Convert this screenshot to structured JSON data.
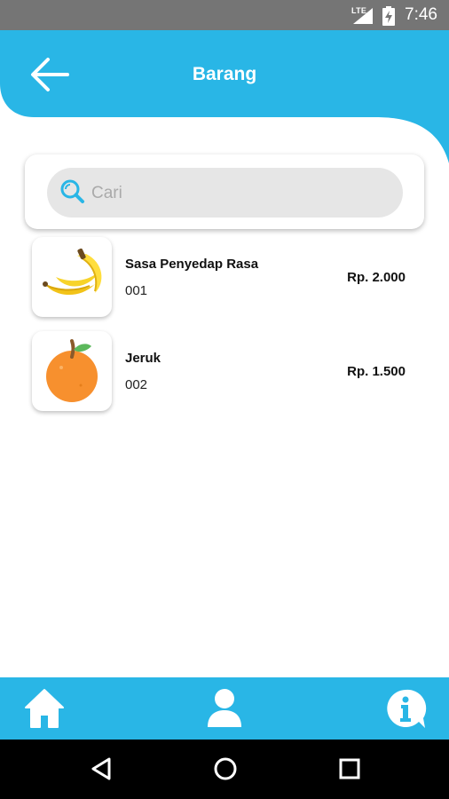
{
  "status_bar": {
    "network": "LTE",
    "time": "7:46"
  },
  "header": {
    "title": "Barang",
    "back_icon": "arrow-left-icon",
    "color": "#29b6e6"
  },
  "search": {
    "placeholder": "Cari",
    "value": "",
    "icon": "search-icon"
  },
  "items": [
    {
      "name": "Sasa Penyedap Rasa",
      "code": "001",
      "price": "Rp. 2.000",
      "icon": "banana-icon"
    },
    {
      "name": "Jeruk",
      "code": "002",
      "price": "Rp. 1.500",
      "icon": "orange-icon"
    }
  ],
  "bottom_nav": {
    "items": [
      "home-icon",
      "user-icon",
      "info-icon"
    ],
    "color": "#29b6e6"
  },
  "system_nav": {
    "items": [
      "back-triangle-icon",
      "home-circle-icon",
      "recents-square-icon"
    ]
  }
}
